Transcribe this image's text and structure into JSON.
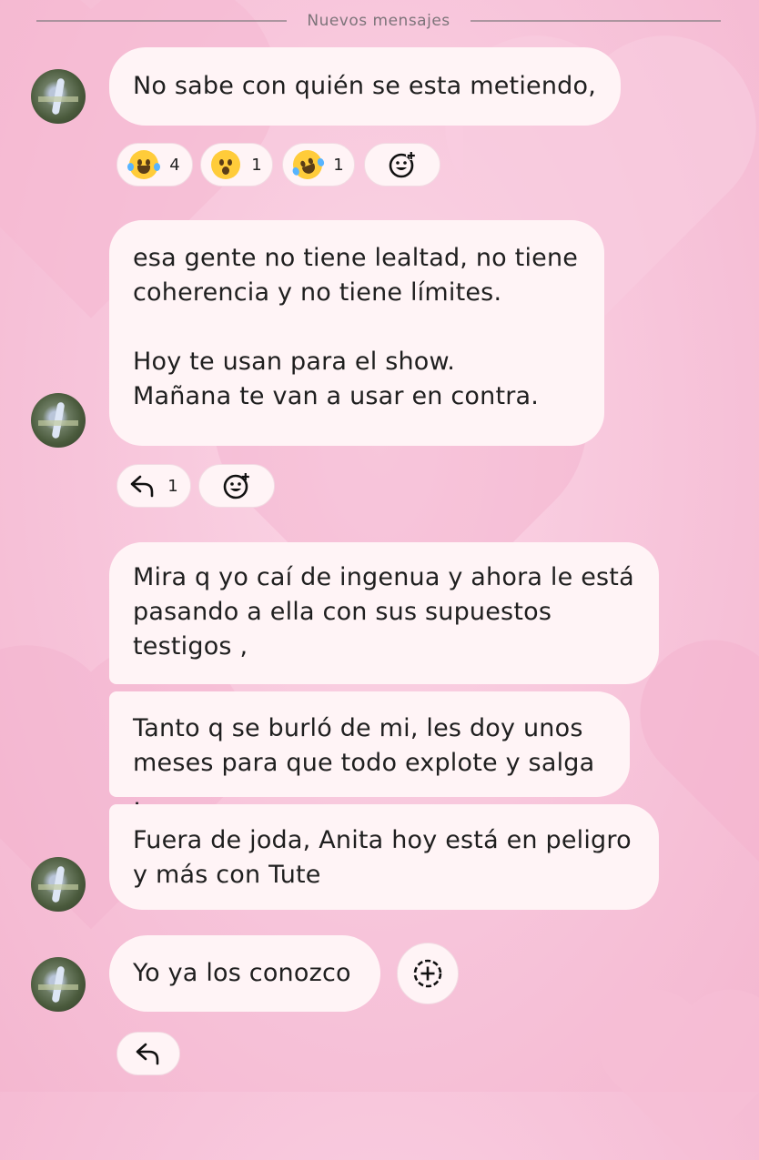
{
  "divider": {
    "label": "Nuevos mensajes"
  },
  "messages": [
    {
      "lines": "No sabe con quién se esta metiendo,"
    },
    {
      "lines": "esa gente no tiene lealtad, no tiene\ncoherencia y no tiene límites.\n\nHoy te usan para el show.\nMañana te van a usar en contra."
    },
    {
      "lines": "Mira q yo caí de ingenua y ahora le está\npasando a ella con sus supuestos\ntestigos ,"
    },
    {
      "lines": "Tanto q se burló de mi, les doy unos\nmeses para que todo explote y salga ,"
    },
    {
      "lines": "Fuera de joda, Anita hoy está en peligro\ny más con Tute"
    },
    {
      "lines": "Yo ya los conozco"
    }
  ],
  "reactions": [
    {
      "emoji": "face-with-tears-of-joy-icon",
      "count": "4"
    },
    {
      "emoji": "face-with-open-mouth-icon",
      "count": "1"
    },
    {
      "emoji": "rolling-on-floor-laughing-icon",
      "count": "1"
    }
  ],
  "replies": {
    "count": "1"
  },
  "colors": {
    "bubble": "#fff4f6",
    "background": "#f7c4da",
    "text": "#1f1f1f"
  }
}
